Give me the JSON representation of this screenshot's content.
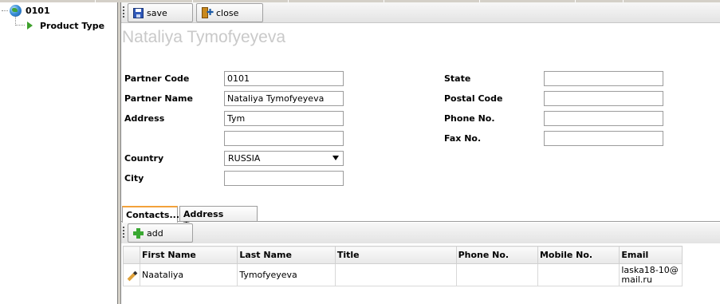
{
  "tree": {
    "root_label": "0101",
    "child_label": "Product Type"
  },
  "toolbar": {
    "save_label": "save",
    "close_label": "close"
  },
  "form": {
    "title": "Nataliya Tymofyeyeva",
    "labels": {
      "partner_code": "Partner Code",
      "partner_name": "Partner Name",
      "address": "Address",
      "country": "Country",
      "city": "City",
      "state": "State",
      "postal_code": "Postal Code",
      "phone_no": "Phone No.",
      "fax_no": "Fax No."
    },
    "values": {
      "partner_code": "0101",
      "partner_name": "Nataliya Tymofyeyeva",
      "address1": "Tym",
      "address2": "",
      "country": "RUSSIA",
      "city": "",
      "state": "",
      "postal_code": "",
      "phone_no": "",
      "fax_no": ""
    }
  },
  "tabs": [
    {
      "label": "Contacts..."
    },
    {
      "label": "Address Types..."
    }
  ],
  "contacts_toolbar": {
    "add_label": "add"
  },
  "contacts_table": {
    "columns": [
      "First Name",
      "Last Name",
      "Title",
      "Phone No.",
      "Mobile No.",
      "Email"
    ],
    "rows": [
      {
        "first_name": "Naataliya",
        "last_name": "Tymofyeyeva",
        "title": "",
        "phone_no": "",
        "mobile_no": "",
        "email": "laska18-10@mail.ru"
      }
    ]
  },
  "colors": {
    "title_gray": "#c9c9c9",
    "active_tab_accent": "#f3a23a",
    "add_icon_green": "#39a832"
  }
}
